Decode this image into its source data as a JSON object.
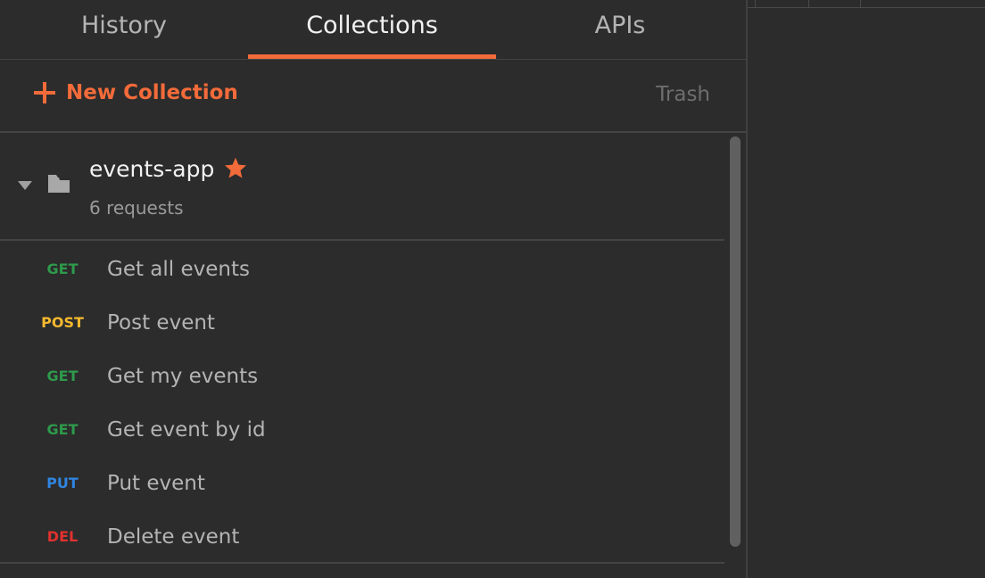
{
  "tabs": [
    {
      "label": "History"
    },
    {
      "label": "Collections",
      "active": true
    },
    {
      "label": "APIs"
    }
  ],
  "actions": {
    "new_collection_label": "New Collection",
    "trash_label": "Trash"
  },
  "collection": {
    "name": "events-app",
    "count_label": "6 requests",
    "starred": true,
    "expanded": true
  },
  "requests": [
    {
      "method": "GET",
      "name": "Get all events"
    },
    {
      "method": "POST",
      "name": "Post event"
    },
    {
      "method": "GET",
      "name": "Get my events"
    },
    {
      "method": "GET",
      "name": "Get event by id"
    },
    {
      "method": "PUT",
      "name": "Put event"
    },
    {
      "method": "DEL",
      "name": "Delete event"
    }
  ],
  "method_colors": {
    "GET": "#2e9a4b",
    "POST": "#f4b92e",
    "PUT": "#2f85e0",
    "DEL": "#e0322e"
  },
  "colors": {
    "accent": "#f26b3a",
    "background": "#2c2c2c"
  }
}
